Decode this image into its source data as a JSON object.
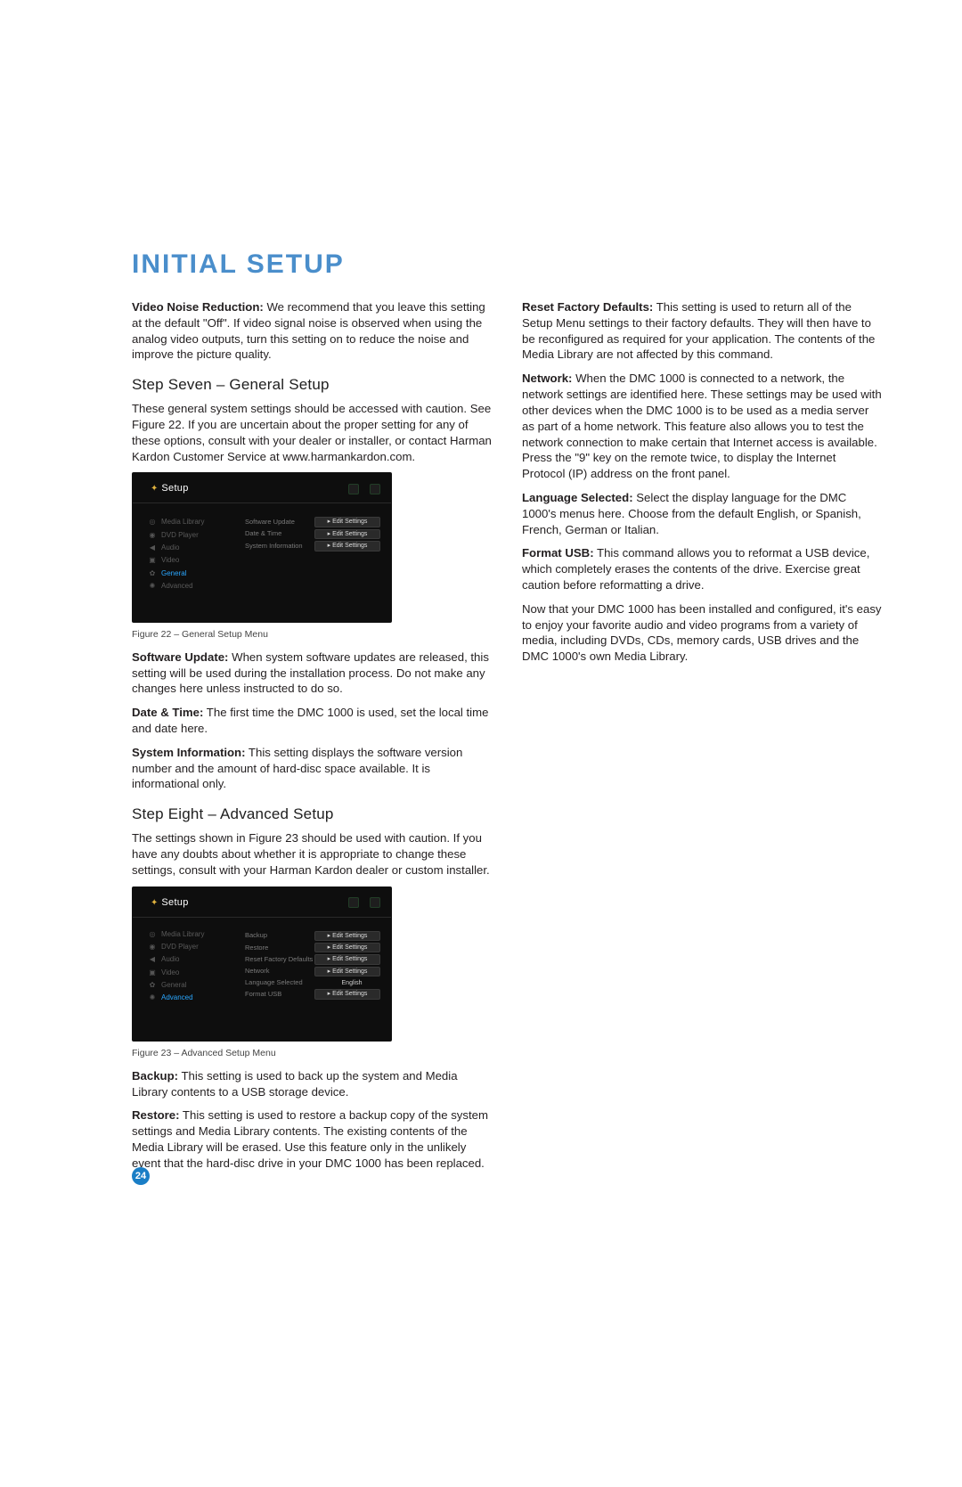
{
  "title": "INITIAL SETUP",
  "pageNumber": "24",
  "left": {
    "videoNoiseLabel": "Video Noise Reduction:",
    "videoNoiseText": " We recommend that you leave this setting at the default \"Off\". If video signal noise is observed when using the analog video outputs, turn this setting on to reduce the noise and improve the picture quality.",
    "step7Title": "Step Seven – General Setup",
    "step7Intro": "These general system settings should be accessed with caution. See Figure 22. If you are uncertain about the proper setting for any of these options, consult with your dealer or installer, or contact Harman Kardon Customer Service at www.harmankardon.com.",
    "fig22Caption": "Figure 22 – General Setup Menu",
    "softwareUpdateLabel": "Software Update:",
    "softwareUpdateText": " When system software updates are released, this setting will be used during the installation process. Do not make any changes here unless instructed to do so.",
    "dateTimeLabel": "Date & Time:",
    "dateTimeText": " The first time the DMC 1000 is used, set the local time and date here.",
    "sysInfoLabel": "System Information:",
    "sysInfoText": " This setting displays the software version number and the amount of hard-disc space available. It is informational only.",
    "step8Title": "Step Eight – Advanced Setup",
    "step8Intro": "The settings shown in Figure 23 should be used with caution. If you have any doubts about whether it is appropriate to change these settings, consult with your Harman Kardon dealer or custom installer.",
    "fig23Caption": "Figure 23 – Advanced Setup Menu",
    "backupLabel": "Backup:",
    "backupText": " This setting is used to back up the system and Media Library contents to a USB storage device.",
    "restoreLabel": "Restore:",
    "restoreText": " This setting is used to restore a backup copy of the system settings and Media Library contents. The existing contents of the Media Library will be erased. Use this feature only in the unlikely event that the hard-disc drive in your DMC 1000 has been replaced."
  },
  "right": {
    "resetLabel": "Reset Factory Defaults:",
    "resetText": " This setting is used to return all of the Setup Menu settings to their factory defaults. They will then have to be reconfigured as required for your application. The contents of the Media Library are not affected by this command.",
    "networkLabel": "Network:",
    "networkText": " When the DMC 1000 is connected to a network, the network settings are identified here. These settings may be used with other devices when the DMC 1000 is to be used as a media server as part of a home network. This feature also allows you to test the network connection to make certain that Internet access is available. Press the \"9\" key on the remote twice, to display the Internet Protocol (IP) address on the front panel.",
    "langLabel": "Language Selected:",
    "langText": " Select the display language for the DMC 1000's menus here. Choose from the default English, or Spanish, French, German or Italian.",
    "usbLabel": "Format USB:",
    "usbText": " This command allows you to reformat a USB device, which completely erases the contents of the drive. Exercise great caution before reformatting a drive.",
    "outro": "Now that your DMC 1000 has been installed and configured, it's easy to enjoy your favorite audio and video programs from a variety of media, including DVDs, CDs, memory cards, USB drives and the DMC 1000's own Media Library."
  },
  "shot22": {
    "title": "Setup",
    "nav": [
      "Media Library",
      "DVD Player",
      "Audio",
      "Video",
      "General",
      "Advanced"
    ],
    "activeIndex": 4,
    "rows": [
      {
        "label": "Software Update",
        "value": "Edit Settings"
      },
      {
        "label": "Date & Time",
        "value": "Edit Settings"
      },
      {
        "label": "System Information",
        "value": "Edit Settings"
      }
    ]
  },
  "shot23": {
    "title": "Setup",
    "nav": [
      "Media Library",
      "DVD Player",
      "Audio",
      "Video",
      "General",
      "Advanced"
    ],
    "activeIndex": 5,
    "rows": [
      {
        "label": "Backup",
        "value": "Edit Settings"
      },
      {
        "label": "Restore",
        "value": "Edit Settings"
      },
      {
        "label": "Reset Factory Defaults",
        "value": "Edit Settings"
      },
      {
        "label": "Network",
        "value": "Edit Settings"
      },
      {
        "label": "Language Selected",
        "value": "English",
        "plain": true
      },
      {
        "label": "Format USB",
        "value": "Edit Settings"
      }
    ]
  },
  "navGlyphs": [
    "◎",
    "◉",
    "◀",
    "▣",
    "✿",
    "✺"
  ]
}
